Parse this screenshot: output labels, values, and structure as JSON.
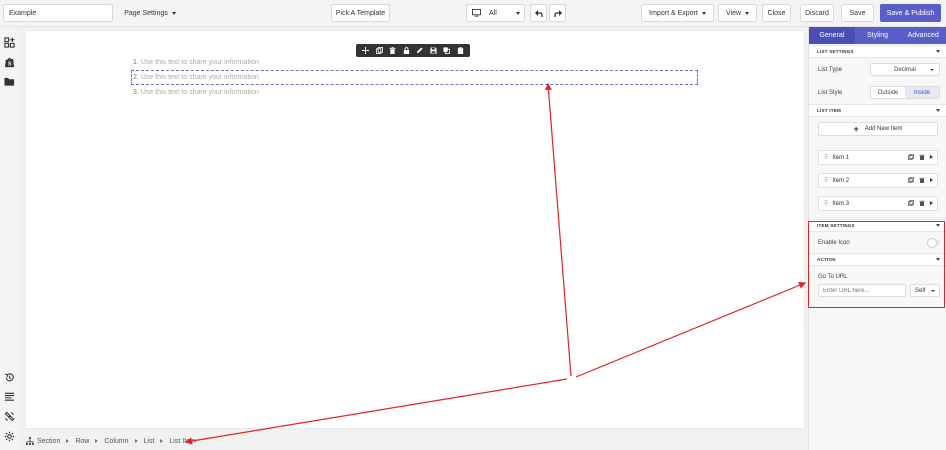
{
  "topbar": {
    "title_value": "Example",
    "page_settings": "Page Settings",
    "pick_template": "Pick A Template",
    "device": "All",
    "import_export": "Import & Export",
    "view": "View",
    "close": "Close",
    "discard": "Discard",
    "save": "Save",
    "save_publish": "Save & Publish"
  },
  "canvas": {
    "list_items": [
      {
        "num": "1.",
        "text": "Use this text to share your information"
      },
      {
        "num": "2.",
        "text": "Use this text to share your information"
      },
      {
        "num": "3.",
        "text": "Use this text to share your information"
      }
    ]
  },
  "breadcrumb": [
    "Section",
    "Row",
    "Column",
    "List",
    "List Item"
  ],
  "panel": {
    "tabs": [
      "General",
      "Styling",
      "Advanced"
    ],
    "list_settings": {
      "heading": "LIST SETTINGS",
      "list_type_label": "List Type",
      "list_type_value": "Decimal",
      "list_style_label": "List Style",
      "style_options": [
        "Outside",
        "Inside"
      ]
    },
    "list_item": {
      "heading": "LIST ITEM",
      "add_label": "Add New Item",
      "items": [
        "Item 1",
        "Item 2",
        "Item 3"
      ]
    },
    "item_settings": {
      "heading": "ITEM SETTINGS",
      "enable_icon_label": "Enable Icon"
    },
    "action": {
      "heading": "ACTION",
      "go_to_url_label": "Go To URL",
      "url_placeholder": "Enter URL here...",
      "target_value": "Self"
    }
  },
  "colors": {
    "accent": "#5a5fc7",
    "annotation": "#e02424"
  },
  "icons": [
    "add-element-icon",
    "shopify-icon",
    "folder-icon",
    "history-icon",
    "layers-icon",
    "plugin-icon",
    "settings-icon",
    "desktop-icon",
    "undo-icon",
    "redo-icon"
  ]
}
